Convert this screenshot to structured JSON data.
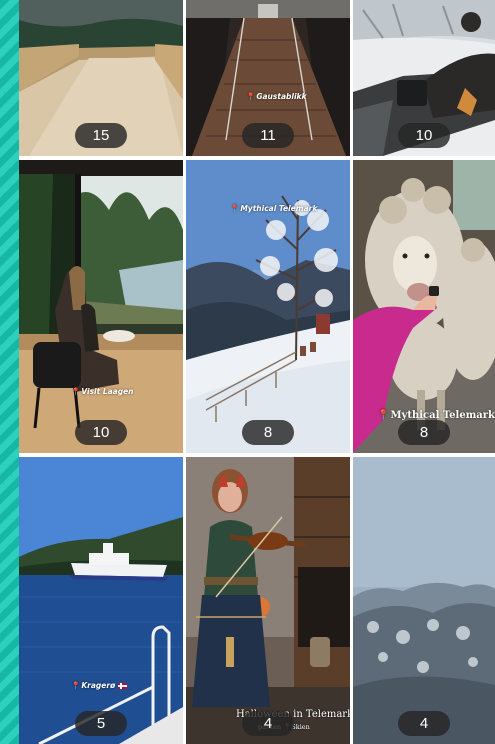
{
  "grid": {
    "tiles": [
      {
        "count": "15"
      },
      {
        "count": "11",
        "location": "Gaustablikk"
      },
      {
        "count": "10"
      },
      {
        "count": "10",
        "location": "Visit Laagen"
      },
      {
        "count": "8",
        "location": "Mythical Telemark"
      },
      {
        "count": "8",
        "location": "Mythical Telemark"
      },
      {
        "count": "5",
        "location": "Kragerø"
      },
      {
        "count": "4",
        "caption_title": "Halloween in Telemark",
        "caption_sub_a": "parken",
        "caption_sub_b": "Skien"
      },
      {
        "count": "4"
      }
    ]
  },
  "icons": {
    "pin": "location-pin-icon",
    "flag": "norway-flag-icon"
  },
  "colors": {
    "badge_bg": "#262626",
    "badge_text": "#ffffff",
    "pin": "#e33b3b",
    "side_stripe": "#17b7a5"
  }
}
